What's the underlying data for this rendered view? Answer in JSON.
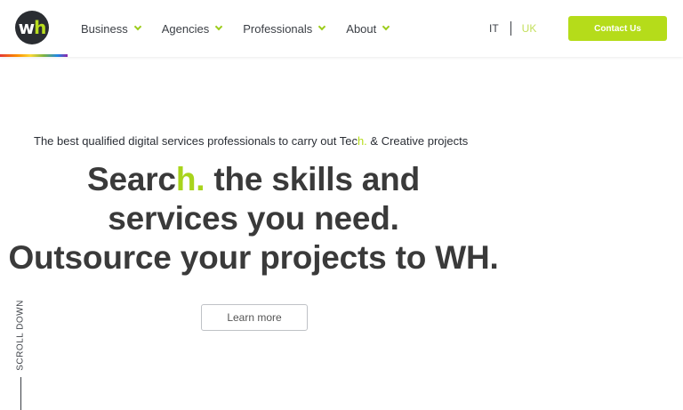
{
  "header": {
    "logo": {
      "text_main": "w",
      "text_accent": "h"
    },
    "nav": [
      {
        "label": "Business",
        "icon": "chevron-down-icon"
      },
      {
        "label": "Agencies",
        "icon": "chevron-down-icon"
      },
      {
        "label": "Professionals",
        "icon": "chevron-down-icon"
      },
      {
        "label": "About",
        "icon": "chevron-down-icon"
      }
    ],
    "languages": {
      "it": "IT",
      "uk": "UK",
      "active": "UK"
    },
    "contact_label": "Contact Us"
  },
  "hero": {
    "tagline_before": "The best qualified digital services professionals to carry out Tec",
    "tagline_accent": "h.",
    "tagline_after": " & Creative projects",
    "headline_line1_before": "Searc",
    "headline_line1_accent": "h.",
    "headline_line1_after": " the skills and",
    "headline_line2": "services you need.",
    "headline_line3": "Outsource your projects to WH.",
    "learn_more": "Learn more"
  },
  "scroll": {
    "label": "SCROLL DOWN"
  },
  "colors": {
    "accent": "#b5dc1a",
    "text_dark": "#3a3a3a",
    "logo_bg": "#2a2d32"
  }
}
